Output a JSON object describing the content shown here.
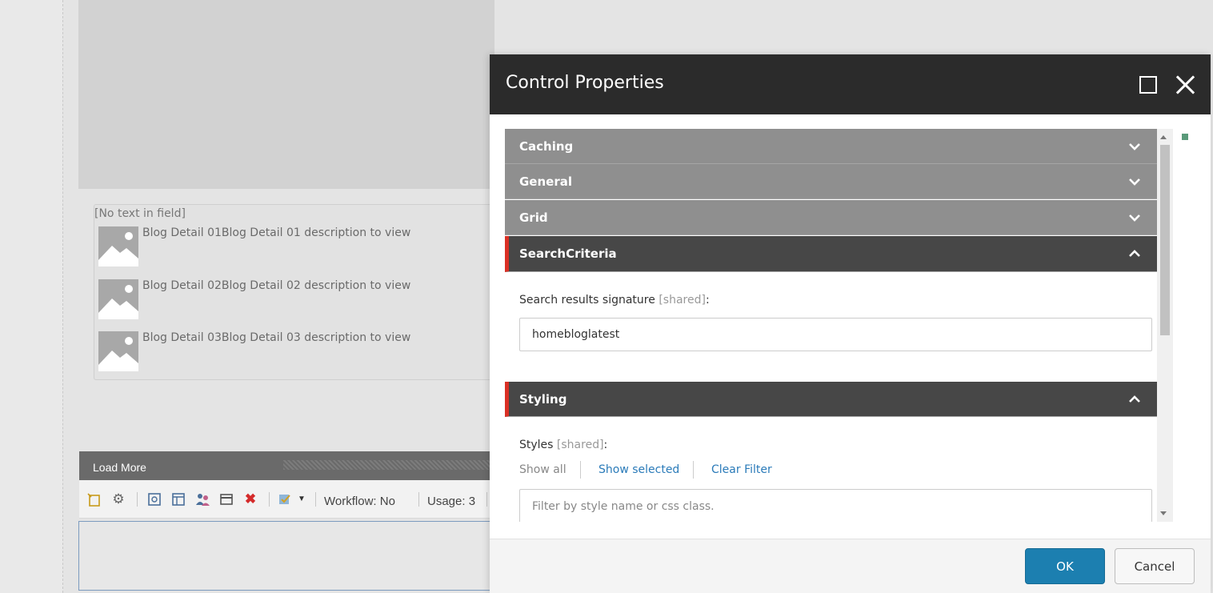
{
  "page": {
    "no_text_placeholder": "[No text in field]",
    "blog_items": [
      {
        "text": "Blog Detail 01Blog Detail 01 description to view",
        "image_icon": "image-placeholder-icon"
      },
      {
        "text": "Blog Detail 02Blog Detail 02 description to view",
        "image_icon": "image-placeholder-icon"
      },
      {
        "text": "Blog Detail 03Blog Detail 03 description to view",
        "image_icon": "image-placeholder-icon"
      }
    ],
    "rendering_bar": {
      "title": "Load More"
    },
    "toolbar": {
      "workflow": "Workflow: No",
      "usage": "Usage: 3",
      "icons": [
        "new-item-icon",
        "gear-icon",
        "refresh-icon",
        "layout-icon",
        "personalize-icon",
        "window-icon",
        "delete-icon",
        "test-icon"
      ]
    }
  },
  "dialog": {
    "title": "Control Properties",
    "sections": [
      {
        "label": "Caching",
        "expanded": false
      },
      {
        "label": "General",
        "expanded": false
      },
      {
        "label": "Grid",
        "expanded": false
      },
      {
        "label": "SearchCriteria",
        "expanded": true
      },
      {
        "label": "Styling",
        "expanded": true
      }
    ],
    "search_criteria": {
      "label": "Search results signature",
      "shared": "[shared]",
      "colon": ":",
      "value": "homebloglatest"
    },
    "styling": {
      "label": "Styles",
      "shared": "[shared]",
      "colon": ":",
      "links": {
        "show_all": "Show all",
        "show_selected": "Show selected",
        "clear_filter": "Clear Filter"
      },
      "filter_placeholder": "Filter by style name or css class."
    },
    "buttons": {
      "ok": "OK",
      "cancel": "Cancel"
    }
  },
  "colors": {
    "header_bg": "#2b2b2b",
    "section_collapsed": "#8f8f8f",
    "section_expanded": "#474747",
    "accent_red": "#d93025",
    "link_blue": "#2b7bb9",
    "ok_button": "#1c7fb0"
  }
}
